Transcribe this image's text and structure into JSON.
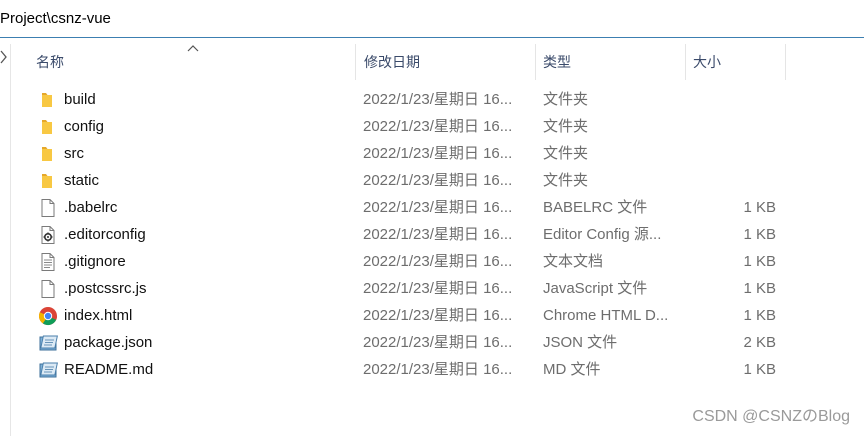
{
  "address": {
    "path": "Project\\csnz-vue"
  },
  "columns": {
    "name": "名称",
    "modified": "修改日期",
    "type": "类型",
    "size": "大小"
  },
  "files": [
    {
      "name": "build",
      "modified": "2022/1/23/星期日 16...",
      "type": "文件夹",
      "size": "",
      "icon": "folder-icon"
    },
    {
      "name": "config",
      "modified": "2022/1/23/星期日 16...",
      "type": "文件夹",
      "size": "",
      "icon": "folder-icon"
    },
    {
      "name": "src",
      "modified": "2022/1/23/星期日 16...",
      "type": "文件夹",
      "size": "",
      "icon": "folder-icon"
    },
    {
      "name": "static",
      "modified": "2022/1/23/星期日 16...",
      "type": "文件夹",
      "size": "",
      "icon": "folder-icon"
    },
    {
      "name": ".babelrc",
      "modified": "2022/1/23/星期日 16...",
      "type": "BABELRC 文件",
      "size": "1 KB",
      "icon": "blank-file-icon"
    },
    {
      "name": ".editorconfig",
      "modified": "2022/1/23/星期日 16...",
      "type": "Editor Config 源...",
      "size": "1 KB",
      "icon": "config-file-icon"
    },
    {
      "name": ".gitignore",
      "modified": "2022/1/23/星期日 16...",
      "type": "文本文档",
      "size": "1 KB",
      "icon": "text-file-icon"
    },
    {
      "name": ".postcssrc.js",
      "modified": "2022/1/23/星期日 16...",
      "type": "JavaScript 文件",
      "size": "1 KB",
      "icon": "blank-file-icon"
    },
    {
      "name": "index.html",
      "modified": "2022/1/23/星期日 16...",
      "type": "Chrome HTML D...",
      "size": "1 KB",
      "icon": "chrome-icon"
    },
    {
      "name": "package.json",
      "modified": "2022/1/23/星期日 16...",
      "type": "JSON 文件",
      "size": "2 KB",
      "icon": "notepad-icon"
    },
    {
      "name": "README.md",
      "modified": "2022/1/23/星期日 16...",
      "type": "MD 文件",
      "size": "1 KB",
      "icon": "notepad-icon"
    }
  ],
  "watermark": "CSDN @CSNZのBlog",
  "colors": {
    "folder": "#f8c843",
    "folder_dark": "#e6a82a",
    "address_border": "#3c7fb1",
    "header_text": "#3a4a6a",
    "muted_text": "#6d6d6d"
  }
}
